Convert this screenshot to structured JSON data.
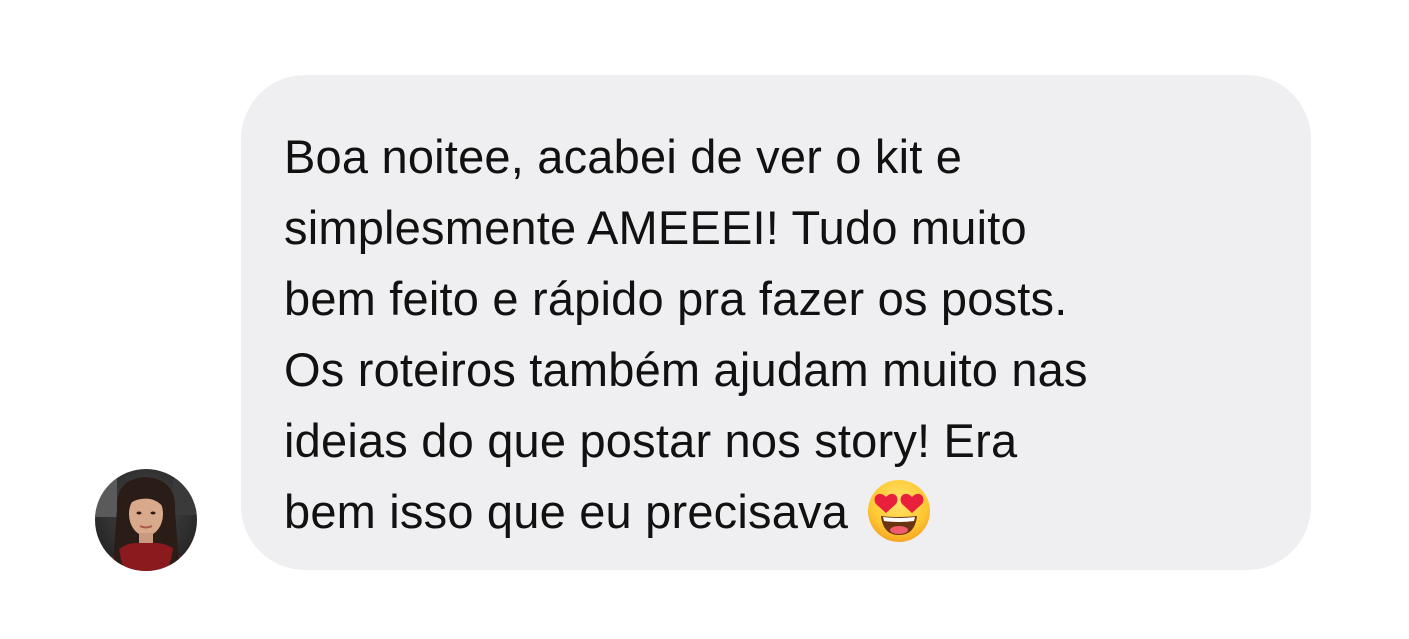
{
  "conversation": {
    "message": {
      "lines": [
        "Boa noitee, acabei de ver o kit e",
        "simplesmente AMEEEI! Tudo muito",
        "bem feito e rápido pra fazer os posts.",
        "Os roteiros também ajudam muito nas",
        "ideias do que postar nos story! Era",
        "bem isso que eu precisava"
      ],
      "emoji": "heart-eyes-emoji"
    },
    "sender": {
      "avatar": "avatar-photo"
    }
  },
  "colors": {
    "bubble_background": "#efeff1",
    "text": "#111111",
    "page_background": "#ffffff"
  }
}
